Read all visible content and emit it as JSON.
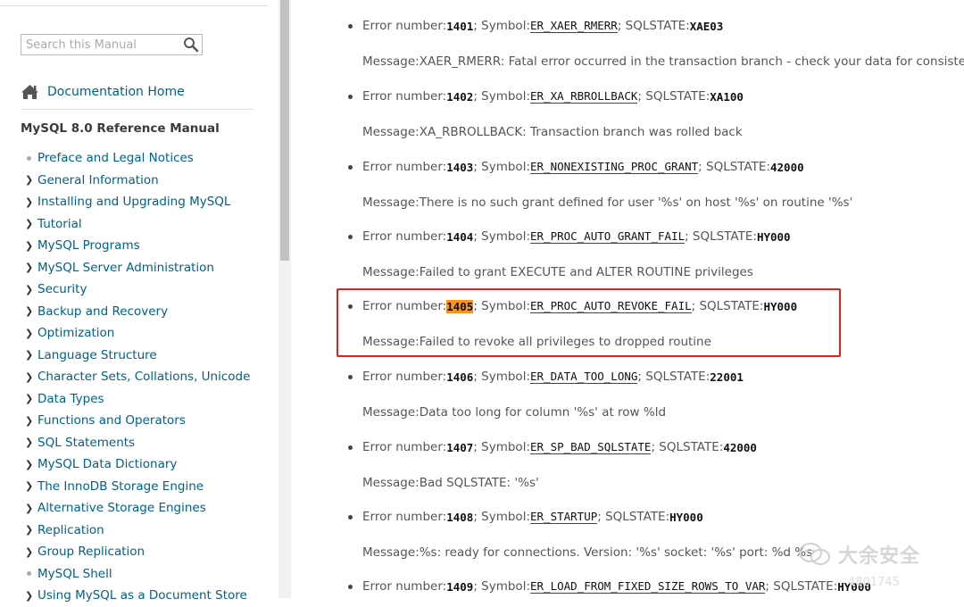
{
  "sidebar": {
    "search_placeholder": "Search this Manual",
    "doc_home": "Documentation Home",
    "manual_title": "MySQL 8.0 Reference Manual",
    "toc": [
      {
        "label": "Preface and Legal Notices",
        "marker": "dot"
      },
      {
        "label": "General Information",
        "marker": "chevron"
      },
      {
        "label": "Installing and Upgrading MySQL",
        "marker": "chevron"
      },
      {
        "label": "Tutorial",
        "marker": "chevron"
      },
      {
        "label": "MySQL Programs",
        "marker": "chevron"
      },
      {
        "label": "MySQL Server Administration",
        "marker": "chevron"
      },
      {
        "label": "Security",
        "marker": "chevron"
      },
      {
        "label": "Backup and Recovery",
        "marker": "chevron"
      },
      {
        "label": "Optimization",
        "marker": "chevron"
      },
      {
        "label": "Language Structure",
        "marker": "chevron"
      },
      {
        "label": "Character Sets, Collations, Unicode",
        "marker": "chevron"
      },
      {
        "label": "Data Types",
        "marker": "chevron"
      },
      {
        "label": "Functions and Operators",
        "marker": "chevron"
      },
      {
        "label": "SQL Statements",
        "marker": "chevron"
      },
      {
        "label": "MySQL Data Dictionary",
        "marker": "chevron"
      },
      {
        "label": "The InnoDB Storage Engine",
        "marker": "chevron"
      },
      {
        "label": "Alternative Storage Engines",
        "marker": "chevron"
      },
      {
        "label": "Replication",
        "marker": "chevron"
      },
      {
        "label": "Group Replication",
        "marker": "chevron"
      },
      {
        "label": "MySQL Shell",
        "marker": "dot"
      },
      {
        "label": "Using MySQL as a Document Store",
        "marker": "chevron"
      }
    ]
  },
  "labels": {
    "error_number": "Error number: ",
    "symbol": "; Symbol: ",
    "sqlstate": "; SQLSTATE: ",
    "message": "Message: "
  },
  "entries": [
    {
      "number": "1401",
      "symbol": "ER_XAER_RMERR",
      "sqlstate": "XAE03",
      "message": "XAER_RMERR: Fatal error occurred in the transaction branch - check your data for consistency"
    },
    {
      "number": "1402",
      "symbol": "ER_XA_RBROLLBACK",
      "sqlstate": "XA100",
      "message": "XA_RBROLLBACK: Transaction branch was rolled back"
    },
    {
      "number": "1403",
      "symbol": "ER_NONEXISTING_PROC_GRANT",
      "sqlstate": "42000",
      "message": "There is no such grant defined for user '%s' on host '%s' on routine '%s'"
    },
    {
      "number": "1404",
      "symbol": "ER_PROC_AUTO_GRANT_FAIL",
      "sqlstate": "HY000",
      "message": "Failed to grant EXECUTE and ALTER ROUTINE privileges"
    },
    {
      "number": "1405",
      "symbol": "ER_PROC_AUTO_REVOKE_FAIL",
      "sqlstate": "HY000",
      "message": "Failed to revoke all privileges to dropped routine",
      "highlighted": true
    },
    {
      "number": "1406",
      "symbol": "ER_DATA_TOO_LONG",
      "sqlstate": "22001",
      "message": "Data too long for column '%s' at row %ld"
    },
    {
      "number": "1407",
      "symbol": "ER_SP_BAD_SQLSTATE",
      "sqlstate": "42000",
      "message": "Bad SQLSTATE: '%s'"
    },
    {
      "number": "1408",
      "symbol": "ER_STARTUP",
      "sqlstate": "HY000",
      "message": "%s: ready for connections. Version: '%s' socket: '%s' port: %d %s"
    },
    {
      "number": "1409",
      "symbol": "ER_LOAD_FROM_FIXED_SIZE_ROWS_TO_VAR",
      "sqlstate": "HY000",
      "message": ""
    }
  ],
  "watermark": {
    "text": "大余安全",
    "sub": "4801745"
  },
  "colors": {
    "link": "#00618a",
    "highlight": "#f7931e",
    "annotation_box": "#e0221f"
  }
}
